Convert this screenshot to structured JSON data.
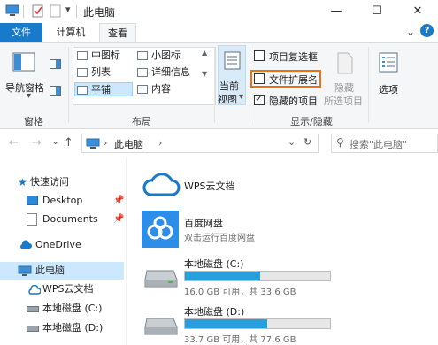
{
  "window": {
    "title": "此电脑",
    "minimize_symbol": "—",
    "maximize_symbol": "☐",
    "close_symbol": "✕"
  },
  "tabs": [
    {
      "label": "文件"
    },
    {
      "label": "计算机"
    },
    {
      "label": "查看"
    }
  ],
  "ribbon": {
    "panes": {
      "nav_pane_label": "导航窗格",
      "group_label": "窗格"
    },
    "layout": {
      "group_label": "布局",
      "items": [
        "中图标",
        "小图标",
        "列表",
        "详细信息",
        "平铺",
        "内容"
      ],
      "selected": "平铺"
    },
    "current_view": {
      "label_line1": "当前",
      "label_line2": "视图",
      "dropdown_symbol": "▾"
    },
    "show_hide": {
      "group_label": "显示/隐藏",
      "item_checkboxes": {
        "label": "项目复选框",
        "checked": false
      },
      "file_extensions": {
        "label": "文件扩展名",
        "checked": false
      },
      "hidden_items": {
        "label": "隐藏的项目",
        "checked": true
      },
      "hide_selected_line1": "隐藏",
      "hide_selected_line2": "所选项目"
    },
    "options_label": "选项",
    "collapse_symbol": "⌄",
    "help_symbol": "?"
  },
  "address": {
    "back": "←",
    "forward": "→",
    "recent": "⌄",
    "up": "↑",
    "chevron": "›",
    "path": "此电脑",
    "dropdown": "⌄",
    "refresh": "↻",
    "search_placeholder": "搜索\"此电脑\""
  },
  "nav_pane": {
    "quick_access": "快速访问",
    "desktop": "Desktop",
    "documents": "Documents",
    "onedrive": "OneDrive",
    "this_pc": "此电脑",
    "wps_cloud": "WPS云文档",
    "local_c": "本地磁盘 (C:)",
    "local_d": "本地磁盘 (D:)"
  },
  "content": {
    "wps_cloud": {
      "title": "WPS云文档"
    },
    "baidu": {
      "title": "百度网盘",
      "subtitle": "双击运行百度网盘"
    },
    "drive_c": {
      "title": "本地磁盘 (C:)",
      "usage": "16.0 GB 可用，共 33.6 GB",
      "used_fraction": 0.52
    },
    "drive_d": {
      "title": "本地磁盘 (D:)",
      "usage": "33.7 GB 可用，共 77.6 GB",
      "used_fraction": 0.57
    }
  },
  "colors": {
    "accent": "#1979ca",
    "highlight_box": "#e8740f",
    "bar_fill": "#26a0da",
    "selected_bg": "#cce8ff"
  }
}
